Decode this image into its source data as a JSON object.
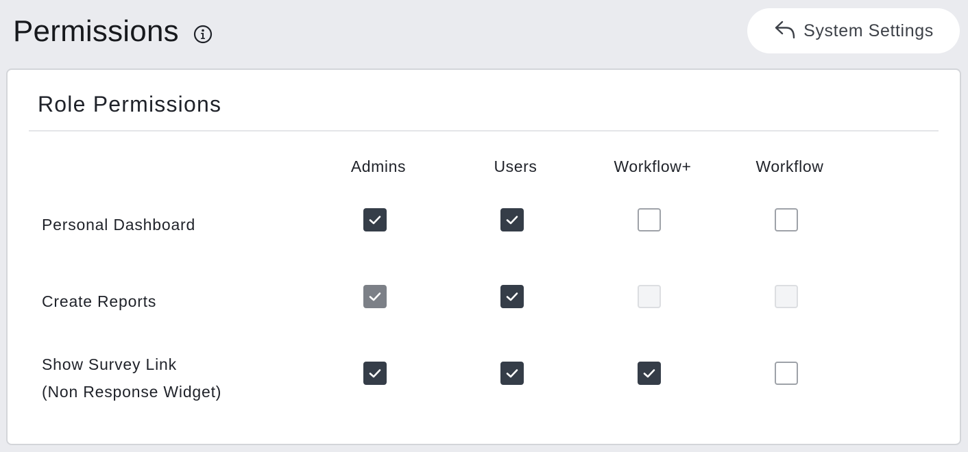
{
  "header": {
    "title": "Permissions",
    "info_icon": "info-circle-icon",
    "system_settings_button": {
      "label": "System Settings",
      "icon": "reply-arrow-icon"
    }
  },
  "card": {
    "title": "Role Permissions",
    "columns": [
      "Admins",
      "Users",
      "Workflow+",
      "Workflow"
    ],
    "rows": [
      {
        "label_lines": [
          "Personal Dashboard"
        ],
        "cells": [
          {
            "checked": true,
            "disabled": false
          },
          {
            "checked": true,
            "disabled": false
          },
          {
            "checked": false,
            "disabled": false
          },
          {
            "checked": false,
            "disabled": false
          }
        ]
      },
      {
        "label_lines": [
          "Create Reports"
        ],
        "cells": [
          {
            "checked": true,
            "disabled": true
          },
          {
            "checked": true,
            "disabled": false
          },
          {
            "checked": false,
            "disabled": true
          },
          {
            "checked": false,
            "disabled": true
          }
        ]
      },
      {
        "label_lines": [
          "Show Survey Link",
          "(Non Response Widget)"
        ],
        "cells": [
          {
            "checked": true,
            "disabled": false
          },
          {
            "checked": true,
            "disabled": false
          },
          {
            "checked": true,
            "disabled": false
          },
          {
            "checked": false,
            "disabled": false
          }
        ]
      }
    ]
  },
  "colors": {
    "page_background": "#eaebef",
    "checkbox_checked": "#353d48",
    "checkbox_checked_disabled": "#7c8087",
    "checkbox_border": "#9ea2a8"
  }
}
